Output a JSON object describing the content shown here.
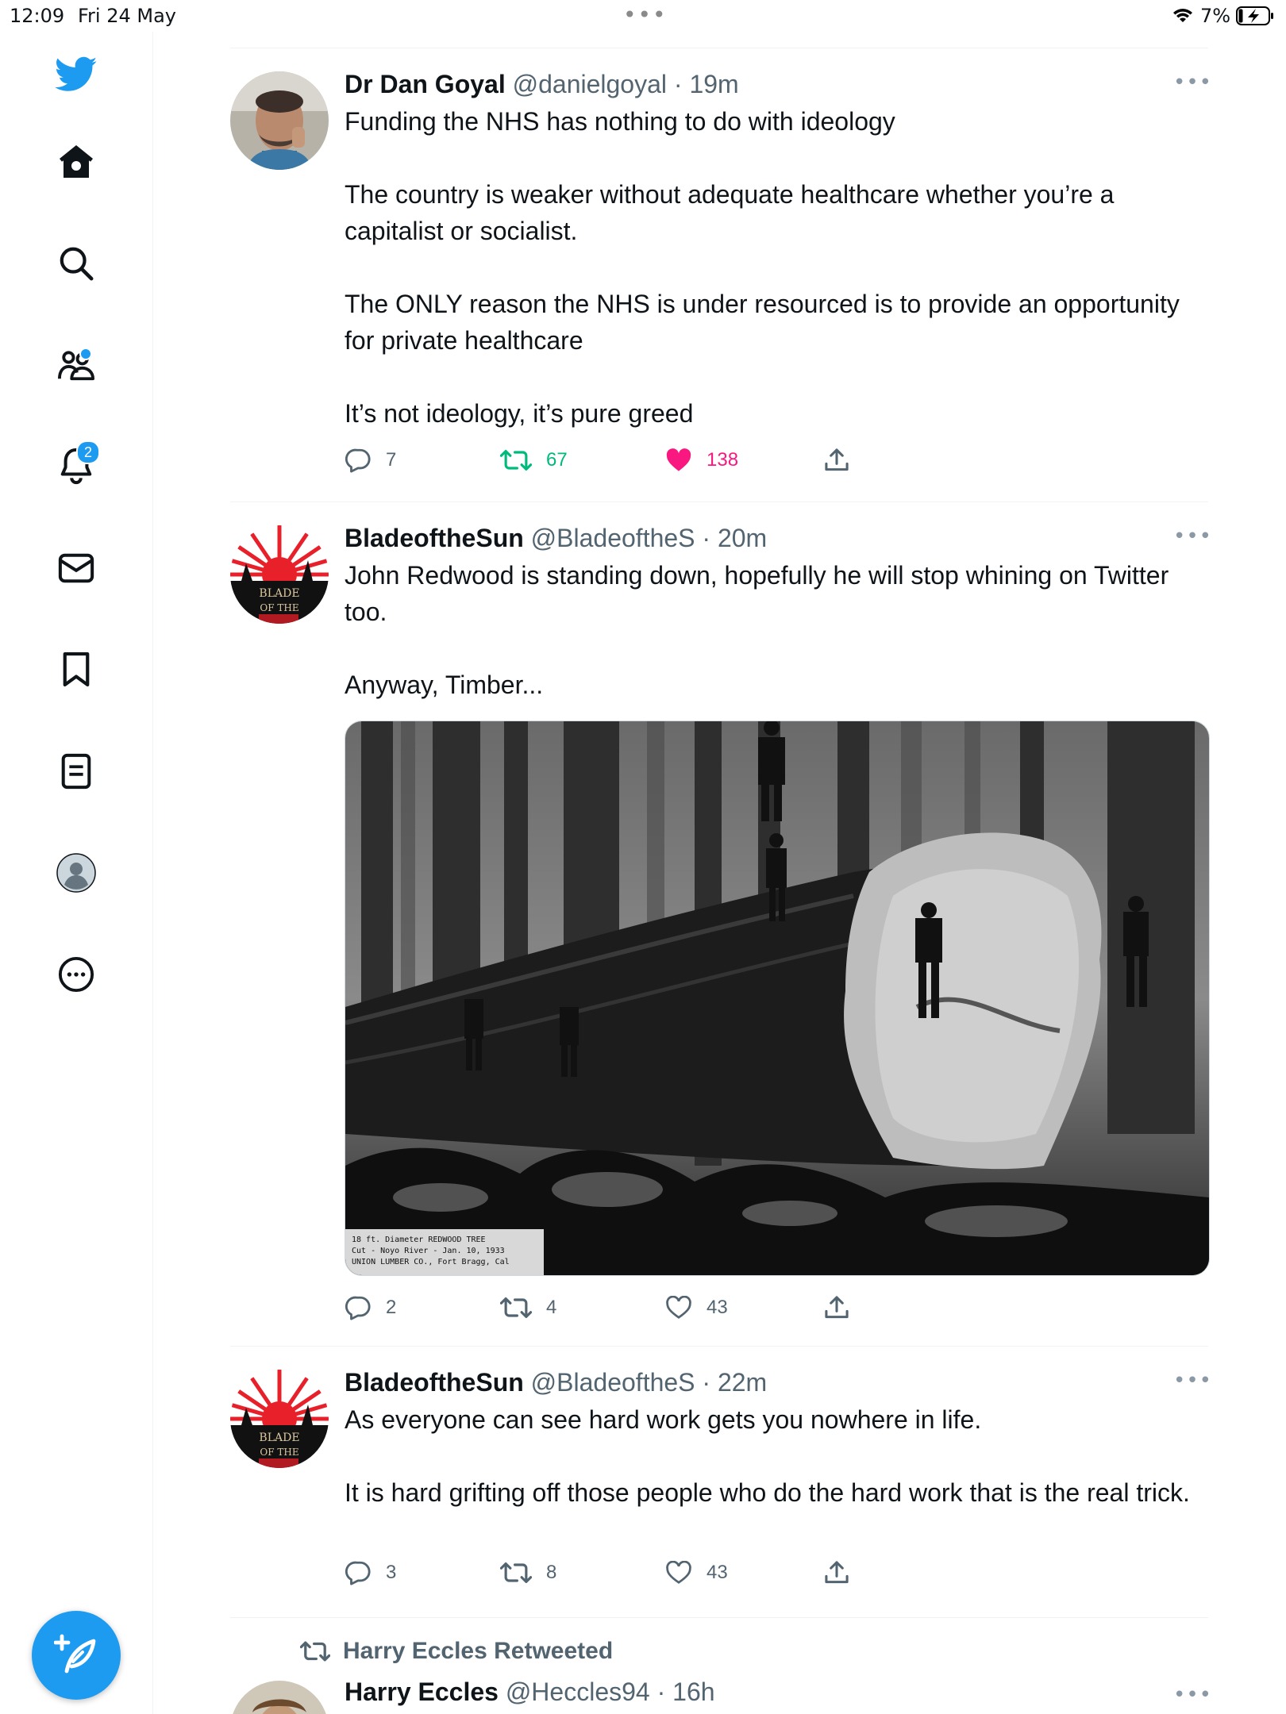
{
  "status_bar": {
    "time": "12:09",
    "date": "Fri 24 May",
    "battery": "7%"
  },
  "sidebar": {
    "items": [
      {
        "name": "twitter-logo-icon"
      },
      {
        "name": "home-icon"
      },
      {
        "name": "search-icon"
      },
      {
        "name": "communities-icon"
      },
      {
        "name": "notifications-icon",
        "badge": "2"
      },
      {
        "name": "messages-icon"
      },
      {
        "name": "bookmarks-icon"
      },
      {
        "name": "lists-icon"
      },
      {
        "name": "profile-icon"
      },
      {
        "name": "more-icon"
      }
    ],
    "accent": "#1d9bf0"
  },
  "tweets": [
    {
      "name": "Dr Dan Goyal",
      "handle": "@danielgoyal",
      "time": "19m",
      "text": "Funding the NHS has nothing to do with ideology\n\nThe country is weaker without adequate healthcare whether you’re a capitalist or socialist.\n\nThe ONLY reason the NHS is under resourced is to provide an opportunity for private healthcare\n\nIt’s not ideology, it’s pure greed",
      "replies": "7",
      "retweets": "67",
      "likes": "138",
      "retweeted": true,
      "liked": true
    },
    {
      "name": "BladeoftheSun",
      "handle": "@BladeoftheS",
      "time": "20m",
      "text": "John Redwood is standing down, hopefully he will stop whining on Twitter too.\n\nAnyway, Timber...",
      "image_caption": "18 ft. Diameter REDWOOD TREE\nCut - Noyo River - Jan. 10, 1933\nUNION LUMBER CO., Fort Bragg, Cal",
      "replies": "2",
      "retweets": "4",
      "likes": "43"
    },
    {
      "name": "BladeoftheSun",
      "handle": "@BladeoftheS",
      "time": "22m",
      "text": "As everyone can see hard work gets you nowhere in life.\n\nIt is hard grifting off those people who do the hard work that is the real trick.",
      "replies": "3",
      "retweets": "8",
      "likes": "43"
    },
    {
      "retweet_label": "Harry Eccles Retweeted",
      "name": "Harry Eccles",
      "handle": "@Heccles94",
      "time": "16h"
    }
  ],
  "avatar_text": "BLADE OF THE SUN"
}
